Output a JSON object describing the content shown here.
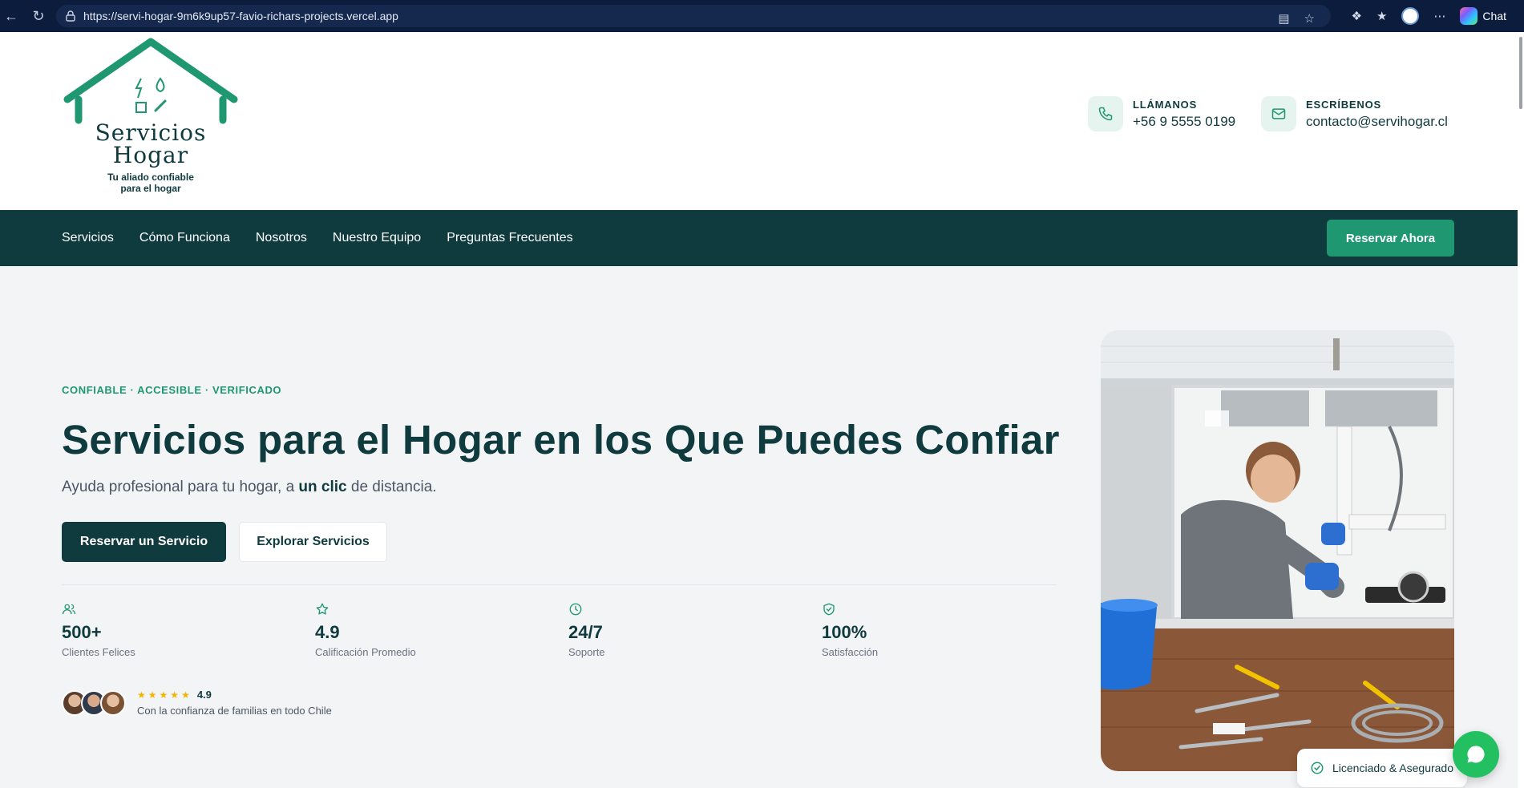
{
  "browser": {
    "url": "https://servi-hogar-9m6k9up57-favio-richars-projects.vercel.app",
    "chat_label": "Chat"
  },
  "header": {
    "logo_title_line1": "Servicios",
    "logo_title_line2": "Hogar",
    "logo_tagline_line1": "Tu aliado confiable",
    "logo_tagline_line2": "para el hogar",
    "phone_label": "LLÁMANOS",
    "phone_value": "+56 9 5555 0199",
    "email_label": "ESCRÍBENOS",
    "email_value": "contacto@servihogar.cl"
  },
  "nav": {
    "items": [
      {
        "label": "Servicios"
      },
      {
        "label": "Cómo Funciona"
      },
      {
        "label": "Nosotros"
      },
      {
        "label": "Nuestro Equipo"
      },
      {
        "label": "Preguntas Frecuentes"
      }
    ],
    "cta": "Reservar Ahora"
  },
  "hero": {
    "eyebrow": "CONFIABLE · ACCESIBLE · VERIFICADO",
    "title": "Servicios para el Hogar en los Que Puedes Confiar",
    "subtitle_pre": "Ayuda profesional para tu hogar, a ",
    "subtitle_bold": "un clic",
    "subtitle_post": " de distancia.",
    "primary_button": "Reservar un Servicio",
    "secondary_button": "Explorar Servicios",
    "stats": [
      {
        "value": "500+",
        "label": "Clientes Felices",
        "icon": "users-icon"
      },
      {
        "value": "4.9",
        "label": "Calificación Promedio",
        "icon": "star-icon"
      },
      {
        "value": "24/7",
        "label": "Soporte",
        "icon": "clock-icon"
      },
      {
        "value": "100%",
        "label": "Satisfacción",
        "icon": "shield-check-icon"
      }
    ],
    "rating": "4.9",
    "star_count": 5,
    "trust_caption": "Con la confianza de familias en todo Chile",
    "badge": "Licenciado & Asegurado"
  },
  "colors": {
    "primary": "#0f3b3f",
    "accent": "#1f9770",
    "whatsapp": "#22c061"
  }
}
